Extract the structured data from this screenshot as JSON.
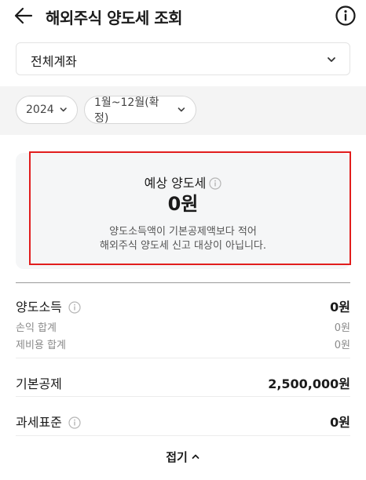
{
  "header": {
    "title": "해외주식 양도세 조회",
    "back_icon": "arrow-left-icon",
    "info_icon": "info-circle-icon"
  },
  "account": {
    "selected": "전체계좌"
  },
  "filters": {
    "year": "2024",
    "period": "1월~12월(확정)"
  },
  "summary": {
    "label": "예상 양도세",
    "amount": "0원",
    "message_line1": "양도소득액이 기본공제액보다 적어",
    "message_line2": "해외주식 양도세 신고 대상이 아닙니다."
  },
  "breakdown": {
    "gain": {
      "label": "양도소득",
      "value": "0원"
    },
    "pnl_total": {
      "label": "손익 합계",
      "value": "0원"
    },
    "fee_total": {
      "label": "제비용 합계",
      "value": "0원"
    },
    "deduction": {
      "label": "기본공제",
      "value": "2,500,000원"
    },
    "tax_base": {
      "label": "과세표준",
      "value": "0원"
    }
  },
  "collapse": {
    "label": "접기"
  },
  "colors": {
    "highlight": "#e11d1d",
    "card_bg": "#f5f6f7",
    "band_bg": "#f4f4f4"
  }
}
